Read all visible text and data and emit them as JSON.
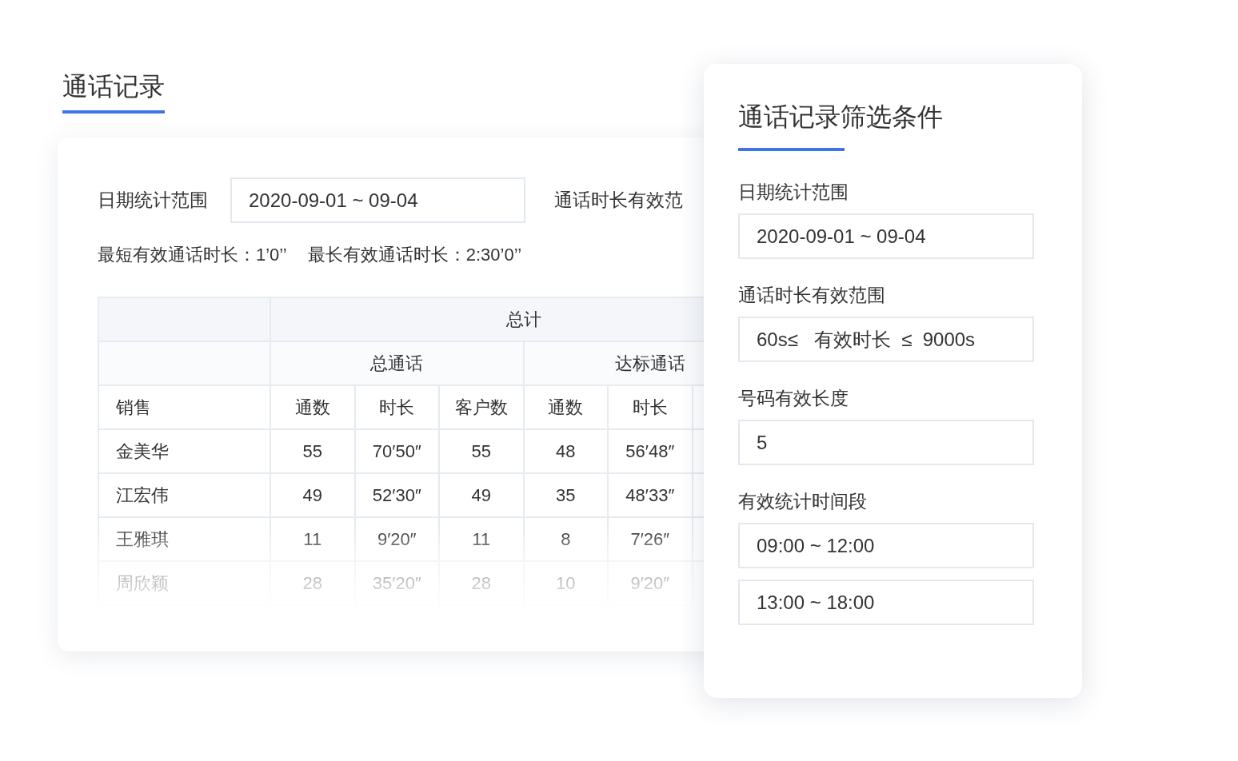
{
  "page_title": "通话记录",
  "filters": {
    "date_label": "日期统计范围",
    "date_value": "2020-09-01 ~ 09-04",
    "duration_label": "通话时长有效范"
  },
  "summary": [
    "最短有效通话时长：1’0’’",
    "最长有效通话时长：2:30’0’’"
  ],
  "table": {
    "group_header": "总计",
    "subgroups": [
      "总通话",
      "达标通话"
    ],
    "columns": [
      "销售",
      "通数",
      "时长",
      "客户数",
      "通数",
      "时长"
    ],
    "rows": [
      [
        "金美华",
        "55",
        "70′50″",
        "55",
        "48",
        "56′48″"
      ],
      [
        "江宏伟",
        "49",
        "52′30″",
        "49",
        "35",
        "48′33″"
      ],
      [
        "王雅琪",
        "11",
        "9′20″",
        "11",
        "8",
        "7′26″"
      ],
      [
        "周欣颖",
        "28",
        "35′20″",
        "28",
        "10",
        "9′20″"
      ]
    ]
  },
  "filter_panel": {
    "title": "通话记录筛选条件",
    "fields": [
      {
        "label": "日期统计范围",
        "values": [
          "2020-09-01 ~ 09-04"
        ]
      },
      {
        "label": "通话时长有效范围",
        "values": [
          "60s≤   有效时长  ≤  9000s"
        ]
      },
      {
        "label": "号码有效长度",
        "values": [
          "5"
        ]
      },
      {
        "label": "有效统计时间段",
        "values": [
          "09:00 ~ 12:00",
          "13:00 ~ 18:00"
        ]
      }
    ]
  }
}
